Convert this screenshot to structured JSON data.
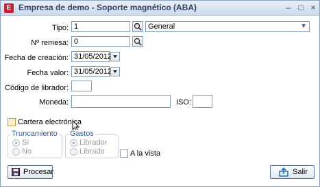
{
  "window": {
    "title": "Empresa de demo - Soporte magnético (ABA)",
    "app_icon_letter": "E",
    "minimize": "–",
    "maximize": "□",
    "close": "×"
  },
  "form": {
    "tipo_label": "Tipo:",
    "tipo_code": "1",
    "tipo_value": "General",
    "remesa_label": "Nº remesa:",
    "remesa_value": "0",
    "creacion_label": "Fecha de creación:",
    "creacion_value": "31/05/2012",
    "valor_label": "Fecha valor:",
    "valor_value": "31/05/2012",
    "librador_label": "Código de librador:",
    "librador_value": "",
    "moneda_label": "Moneda:",
    "moneda_value": "",
    "iso_label": "ISO:",
    "iso_value": "",
    "cartera_label": "Cartera electrónica",
    "truncamiento": {
      "legend": "Truncamiento",
      "options": [
        "Sí",
        "No"
      ]
    },
    "gastos": {
      "legend": "Gastos",
      "options": [
        "Librador",
        "Librado"
      ]
    },
    "vista_label": "A la vista"
  },
  "buttons": {
    "procesar": "Procesar",
    "salir": "Salir"
  }
}
